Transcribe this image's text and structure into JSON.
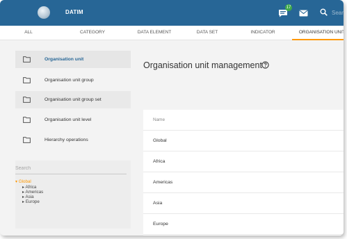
{
  "header": {
    "app_name": "DATIM",
    "notification_count": "17",
    "search_placeholder": "Search"
  },
  "tabs": [
    {
      "label": "ALL"
    },
    {
      "label": "CATEGORY"
    },
    {
      "label": "DATA ELEMENT"
    },
    {
      "label": "DATA SET"
    },
    {
      "label": "INDICATOR"
    },
    {
      "label": "ORGANISATION UNIT",
      "active": true
    }
  ],
  "sidebar": {
    "items": [
      {
        "label": "Organisation unit",
        "active": true,
        "icon": "folder-icon"
      },
      {
        "label": "Organisation unit group",
        "icon": "folder-icon"
      },
      {
        "label": "Organisation unit group set",
        "icon": "folder-icon"
      },
      {
        "label": "Organisation unit level",
        "icon": "folder-icon"
      },
      {
        "label": "Hierarchy operations",
        "icon": "folder-icon"
      }
    ]
  },
  "tree": {
    "search_placeholder": "Search",
    "root": "▾ Global",
    "children": [
      "▸ Africa",
      "▸ Americas",
      "▸ Asia",
      "▸ Europe"
    ]
  },
  "main": {
    "title": "Organisation unit management",
    "table": {
      "column_header": "Name",
      "rows": [
        "Global",
        "Africa",
        "Americas",
        "Asia",
        "Europe"
      ]
    }
  },
  "colors": {
    "header_bg": "#276696",
    "accent": "#ff9800",
    "badge": "#3ea94a"
  }
}
